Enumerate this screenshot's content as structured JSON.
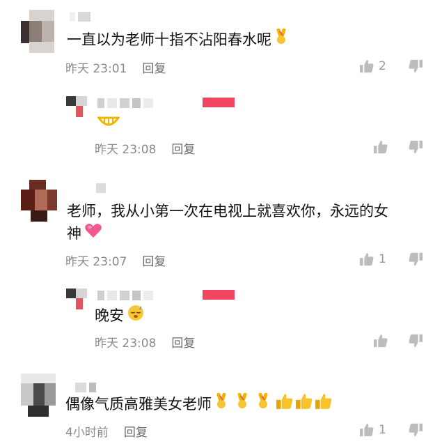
{
  "comments": [
    {
      "text": "一直以为老师十指不沾阳春水呢",
      "time": "昨天 23:01",
      "reply_label": "回复",
      "like_count": "2",
      "emoji": "crossed-fingers",
      "reply": {
        "text": "",
        "emoji": "grin",
        "time": "昨天 23:08",
        "reply_label": "回复",
        "like_count": ""
      }
    },
    {
      "text_line1": "老师，我从小第一次在电视上就喜欢你，永远的女",
      "text_line2": "神",
      "time": "昨天 23:07",
      "reply_label": "回复",
      "like_count": "1",
      "emoji": "pink-heart",
      "reply": {
        "text": "晚安",
        "emoji": "sleepy-face",
        "time": "昨天 23:08",
        "reply_label": "回复",
        "like_count": ""
      }
    },
    {
      "text": "偶像气质高雅美女老师",
      "time": "4小时前",
      "reply_label": "回复",
      "like_count": "1",
      "emoji": "crossed-fingers x3, thumbs-up x3"
    }
  ],
  "colors": {
    "author_badge": "#f2455f",
    "meta_gray": "#8a8a8a",
    "icon_gray": "#9a9a9a"
  }
}
